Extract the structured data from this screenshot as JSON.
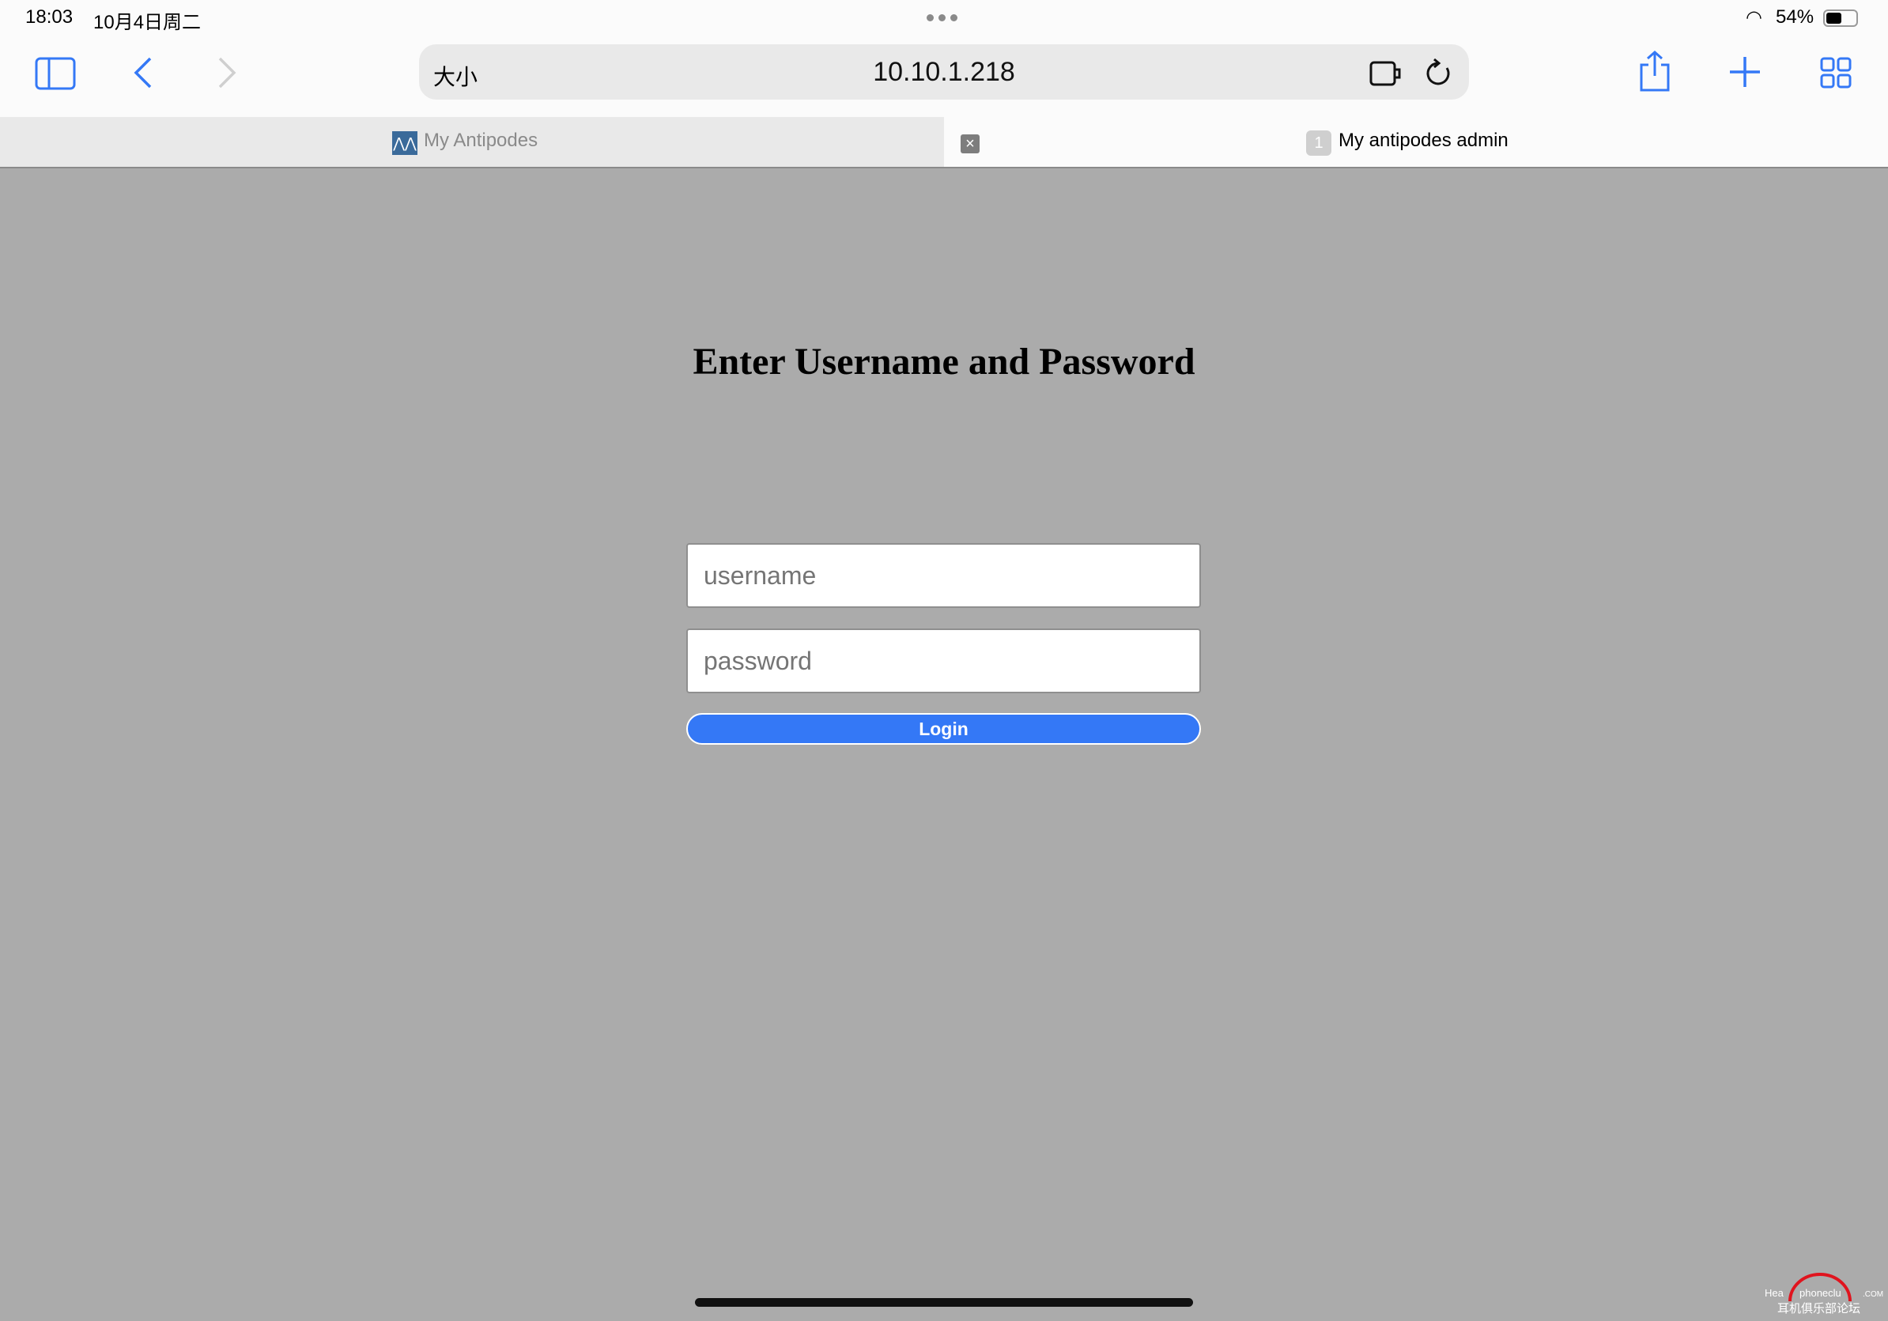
{
  "status_bar": {
    "time": "18:03",
    "date": "10月4日周二",
    "battery": "54%"
  },
  "toolbar": {
    "text_size_label": "大小",
    "address": "10.10.1.218"
  },
  "tabs": [
    {
      "label": "My Antipodes",
      "active": false
    },
    {
      "label": "My antipodes admin",
      "badge": "1",
      "active": true
    }
  ],
  "page": {
    "heading": "Enter Username and Password",
    "username_placeholder": "username",
    "password_placeholder": "password",
    "login_label": "Login"
  },
  "watermark": {
    "brand": "HeadphoneClub.com",
    "subtitle": "耳机俱乐部论坛"
  },
  "colors": {
    "accent": "#3478f6",
    "page_bg": "#ababab"
  }
}
